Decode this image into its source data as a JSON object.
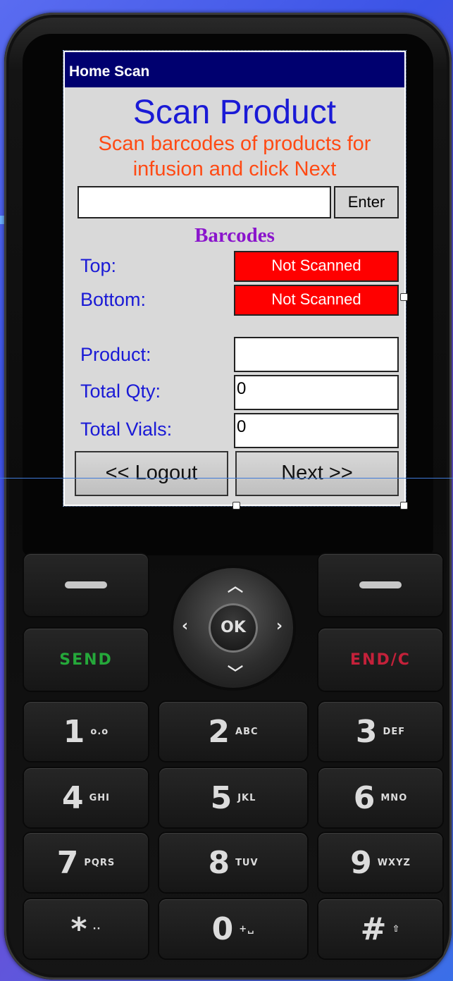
{
  "app": {
    "window_title": "Home Scan",
    "title": "Scan Product",
    "subtitle": "Scan barcodes of products for infusion and click Next",
    "scan_input": {
      "value": ""
    },
    "enter_label": "Enter",
    "barcodes_header": "Barcodes",
    "barcodes": [
      {
        "label": "Top:",
        "status": "Not Scanned"
      },
      {
        "label": "Bottom:",
        "status": "Not Scanned"
      }
    ],
    "fields": [
      {
        "label": "Product:",
        "value": ""
      },
      {
        "label": "Total Qty:",
        "value": "0"
      },
      {
        "label": "Total Vials:",
        "value": "0"
      }
    ],
    "logout_label": "<< Logout",
    "next_label": "Next >>",
    "colors": {
      "titlebar": "#00006f",
      "title": "#1a1ad6",
      "subtitle": "#ff4a14",
      "barcodes_header": "#8a14cc",
      "not_scanned": "#ff0000"
    }
  },
  "keypad": {
    "send_label": "SEND",
    "end_label": "END/C",
    "ok_label": "OK",
    "keys": [
      {
        "digit": "1",
        "letters": "o.o"
      },
      {
        "digit": "2",
        "letters": "ABC"
      },
      {
        "digit": "3",
        "letters": "DEF"
      },
      {
        "digit": "4",
        "letters": "GHI"
      },
      {
        "digit": "5",
        "letters": "JKL"
      },
      {
        "digit": "6",
        "letters": "MNO"
      },
      {
        "digit": "7",
        "letters": "PQRS"
      },
      {
        "digit": "8",
        "letters": "TUV"
      },
      {
        "digit": "9",
        "letters": "WXYZ"
      },
      {
        "digit": "*",
        "letters": "··"
      },
      {
        "digit": "0",
        "letters": "+␣"
      },
      {
        "digit": "#",
        "letters": "⇧"
      }
    ]
  }
}
